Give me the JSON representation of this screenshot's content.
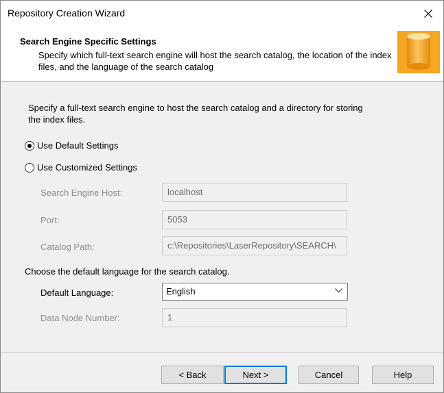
{
  "window": {
    "title": "Repository Creation Wizard"
  },
  "header": {
    "title": "Search Engine Specific Settings",
    "description": "Specify which full-text search engine will host the search catalog, the location of the index files, and the language of the search catalog"
  },
  "main": {
    "intro": "Specify a full-text search engine to host the search catalog and a directory for storing the index files.",
    "options": [
      {
        "label": "Use Default Settings",
        "checked": true
      },
      {
        "label": "Use Customized Settings",
        "checked": false
      }
    ],
    "fields": {
      "host": {
        "label": "Search Engine Host:",
        "value": "localhost"
      },
      "port": {
        "label": "Port:",
        "value": "5053"
      },
      "catalog": {
        "label": "Catalog Path:",
        "value": "c:\\Repositories\\LaserRepository\\SEARCH\\"
      }
    },
    "language_prompt": "Choose the default language for the search catalog.",
    "language": {
      "label": "Default Language:",
      "value": "English"
    },
    "data_node": {
      "label": "Data Node Number:",
      "value": "1"
    }
  },
  "buttons": {
    "back": "< Back",
    "next": "Next >",
    "cancel": "Cancel",
    "help": "Help"
  },
  "colors": {
    "accent": "#0078d7",
    "icon_orange": "#f5a623"
  },
  "icons": {
    "close": "close-icon",
    "header": "database-icon",
    "dropdown": "chevron-down-icon"
  }
}
